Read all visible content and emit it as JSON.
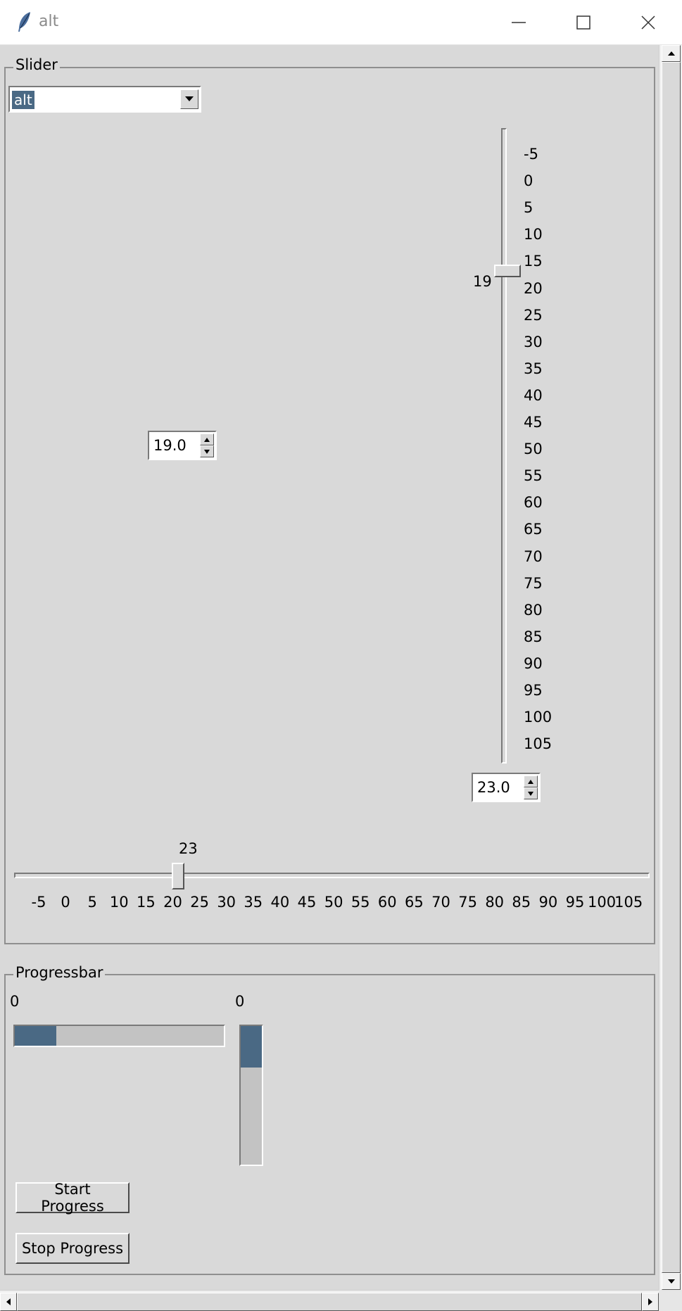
{
  "window": {
    "title": "alt",
    "app_icon": "feather-icon"
  },
  "slider_frame": {
    "title": "Slider",
    "theme_combo": {
      "value": "alt",
      "icon": "chevron-down-icon"
    },
    "vertical_scale": {
      "from": -5,
      "to": 105,
      "value": 19,
      "value_label": "19",
      "ticks": [
        "-5",
        "0",
        "5",
        "10",
        "15",
        "20",
        "25",
        "30",
        "35",
        "40",
        "45",
        "50",
        "55",
        "60",
        "65",
        "70",
        "75",
        "80",
        "85",
        "90",
        "95",
        "100",
        "105"
      ]
    },
    "spinbox_left": {
      "value": "19.0"
    },
    "spinbox_right": {
      "value": "23.0"
    },
    "horizontal_scale": {
      "from": -5,
      "to": 105,
      "value": 23,
      "value_label": "23",
      "ticks": [
        "-5",
        "0",
        "5",
        "10",
        "15",
        "20",
        "25",
        "30",
        "35",
        "40",
        "45",
        "50",
        "55",
        "60",
        "65",
        "70",
        "75",
        "80",
        "85",
        "90",
        "95",
        "100",
        "105"
      ]
    }
  },
  "progress_frame": {
    "title": "Progressbar",
    "horizontal": {
      "label": "0",
      "fill_fraction": 0.2
    },
    "vertical": {
      "label": "0",
      "fill_fraction": 0.3
    },
    "start_button": "Start Progress",
    "stop_button": "Stop Progress"
  },
  "colors": {
    "background": "#d9d9d9",
    "accent": "#4a6984",
    "trough": "#c3c3c3"
  }
}
